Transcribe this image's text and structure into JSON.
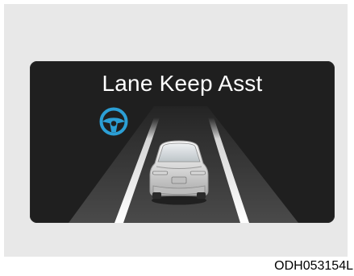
{
  "display": {
    "title": "Lane Keep Asst",
    "icon": "steering-wheel-icon",
    "car_icon": "car-rear-icon",
    "accent_color": "#2c9fd5",
    "road_color": "#3d3d3d",
    "lane_color": "#ffffff"
  },
  "caption": "ODH053154L"
}
